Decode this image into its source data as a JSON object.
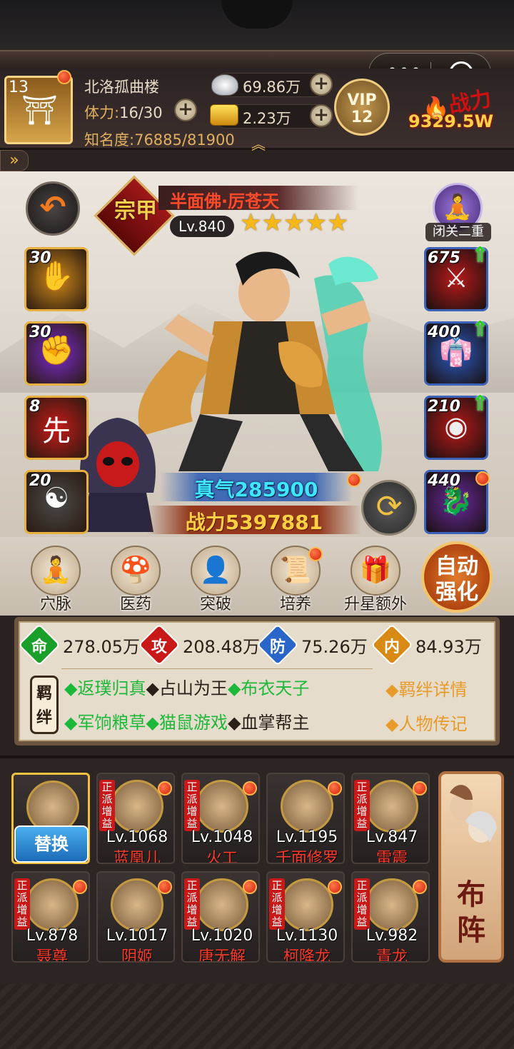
{
  "header": {
    "level": "13",
    "location": "北洛孤曲楼",
    "stamina_label": "体力:",
    "stamina_value": "16/30",
    "fame_label": "知名度:",
    "fame_value": "76885/81900",
    "silver": "69.86万",
    "gold": "2.23万",
    "vip_label": "VIP",
    "vip_level": "12",
    "total_power": "9329.5W"
  },
  "hero": {
    "rank": "宗甲",
    "name": "半面佛·厉苍天",
    "level": "Lv.840",
    "stars": [
      "★",
      "★",
      "★",
      "★",
      "★"
    ],
    "retreat_label": "闭关二重",
    "qi": "真气285900",
    "combat_power": "战力5397881"
  },
  "skills": [
    {
      "num": "30",
      "icon": "palm-icon",
      "glyph": "✋",
      "bg": "#d08a1a"
    },
    {
      "num": "30",
      "icon": "fist-icon",
      "glyph": "✊",
      "bg": "#7a2ad0"
    },
    {
      "num": "8",
      "icon": "first-strike-icon",
      "glyph": "先",
      "bg": "#c81a1a"
    },
    {
      "num": "20",
      "icon": "bagua-icon",
      "glyph": "☯",
      "bg": "#4a4a4a"
    }
  ],
  "equipment": [
    {
      "num": "675",
      "icon": "gauntlet-icon",
      "glyph": "⚔",
      "bg": "#b81a1a",
      "upgrade": true
    },
    {
      "num": "400",
      "icon": "robe-icon",
      "glyph": "👘",
      "bg": "#2a5ac0",
      "upgrade": true
    },
    {
      "num": "210",
      "icon": "amulet-icon",
      "glyph": "◉",
      "bg": "#b81a1a",
      "upgrade": true
    },
    {
      "num": "440",
      "icon": "dragon-mount-icon",
      "glyph": "🐉",
      "bg": "#6a2aa0",
      "upgrade": false
    }
  ],
  "actions": [
    {
      "label": "穴脉",
      "icon": "meridian-icon",
      "glyph": "🧘"
    },
    {
      "label": "医药",
      "icon": "medicine-icon",
      "glyph": "🍄"
    },
    {
      "label": "突破",
      "icon": "breakthrough-icon",
      "glyph": "👤"
    },
    {
      "label": "培养",
      "icon": "cultivate-icon",
      "glyph": "📜"
    },
    {
      "label": "升星额外",
      "icon": "star-up-icon",
      "glyph": "🎁"
    }
  ],
  "auto_button": {
    "line1": "自动",
    "line2": "强化"
  },
  "stats": [
    {
      "ch": "命",
      "value": "278.05万",
      "color": "#1aa02a"
    },
    {
      "ch": "攻",
      "value": "208.48万",
      "color": "#c81818"
    },
    {
      "ch": "防",
      "value": "75.26万",
      "color": "#2a66c8"
    },
    {
      "ch": "内",
      "value": "84.93万",
      "color": "#d88a14"
    }
  ],
  "bond_seal": {
    "line1": "羁",
    "line2": "绊"
  },
  "bonds_row1": [
    {
      "text": "返璞归真",
      "active": true
    },
    {
      "text": "占山为王",
      "active": false
    },
    {
      "text": "布衣天子",
      "active": true
    }
  ],
  "bonds_row2": [
    {
      "text": "军饷粮草",
      "active": true
    },
    {
      "text": "猫鼠游戏",
      "active": true
    },
    {
      "text": "血掌帮主",
      "active": false
    }
  ],
  "bond_links": {
    "detail": "羁绊详情",
    "bio": "人物传记"
  },
  "replace_label": "替换",
  "tag_text": "正派增益",
  "roster": [
    {
      "lv": "Lv.1068",
      "name": "蓝凰儿",
      "tag": true
    },
    {
      "lv": "Lv.1048",
      "name": "火工",
      "tag": true
    },
    {
      "lv": "Lv.1195",
      "name": "千面修罗",
      "tag": false
    },
    {
      "lv": "Lv.847",
      "name": "雷震",
      "tag": true
    },
    {
      "lv": "Lv.878",
      "name": "聂尊",
      "tag": true
    },
    {
      "lv": "Lv.1017",
      "name": "阴姬",
      "tag": false
    },
    {
      "lv": "Lv.1020",
      "name": "唐无解",
      "tag": true
    },
    {
      "lv": "Lv.1130",
      "name": "柯降龙",
      "tag": true
    },
    {
      "lv": "Lv.982",
      "name": "青龙",
      "tag": true
    }
  ],
  "formation": {
    "line1": "布",
    "line2": "阵"
  }
}
